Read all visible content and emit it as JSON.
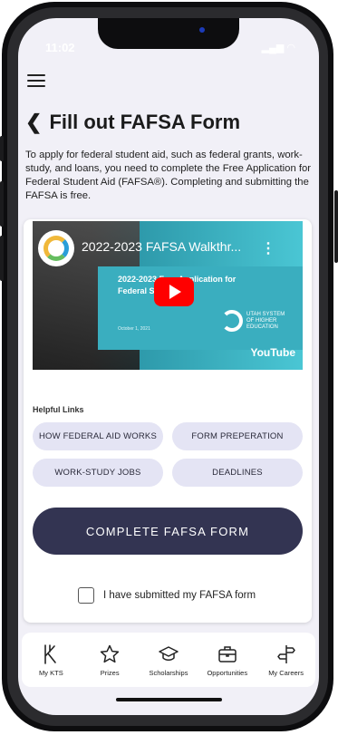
{
  "status_bar": {
    "time": "11:02",
    "icons": "▂▄▆ ◠"
  },
  "header": {
    "title": "Fill out FAFSA Form"
  },
  "intro_text": "To apply for federal student aid, such as federal grants, work-study, and loans, you need to complete the Free Application for Federal Student Aid (FAFSA®). Completing and submitting the FAFSA is free.",
  "video": {
    "title": "2022-2023 FAFSA Walkthr...",
    "slide_line1": "2022-2023 Free Application for",
    "slide_line2": "Federal Student Aid",
    "slide_date": "October 1, 2021",
    "org_name": "UTAH SYSTEM OF HIGHER EDUCATION",
    "platform": "YouTube"
  },
  "helpful_links": {
    "label": "Helpful Links",
    "items": [
      "HOW FEDERAL AID WORKS",
      "FORM PREPERATION",
      "WORK-STUDY JOBS",
      "DEADLINES"
    ]
  },
  "cta": {
    "label": "COMPLETE FAFSA FORM"
  },
  "submitted_checkbox": {
    "label": "I have submitted my FAFSA form",
    "checked": false
  },
  "tabbar": {
    "items": [
      {
        "label": "My KTS",
        "icon": "kts-logo-icon"
      },
      {
        "label": "Prizes",
        "icon": "star-icon"
      },
      {
        "label": "Scholarships",
        "icon": "graduation-cap-icon"
      },
      {
        "label": "Opportunities",
        "icon": "briefcase-icon"
      },
      {
        "label": "My Careers",
        "icon": "signpost-icon"
      }
    ]
  },
  "colors": {
    "primary_dark": "#333452",
    "chip_bg": "#e4e4f4",
    "screen_bg": "#f1f0f7",
    "youtube_red": "#ff0000"
  }
}
